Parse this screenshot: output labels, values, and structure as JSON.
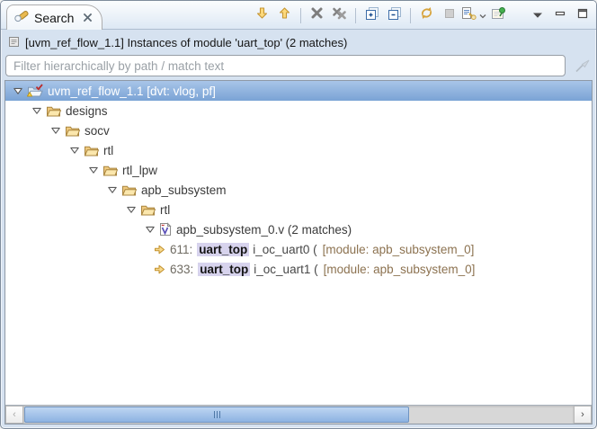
{
  "tab_bar": {
    "active_tab": {
      "label": "Search",
      "icon": "search-flashlight-icon",
      "close_icon": "close-icon"
    },
    "toolbar": {
      "buttons": [
        {
          "name": "show-next-match",
          "icon": "arrow-down-icon"
        },
        {
          "name": "show-previous-match",
          "icon": "arrow-up-icon"
        },
        {
          "type": "separator"
        },
        {
          "name": "remove-selected-match",
          "icon": "remove-match-icon"
        },
        {
          "name": "remove-all-matches",
          "icon": "remove-all-matches-icon"
        },
        {
          "type": "separator"
        },
        {
          "name": "expand-all",
          "icon": "expand-all-icon"
        },
        {
          "name": "collapse-all",
          "icon": "collapse-all-icon"
        },
        {
          "type": "separator"
        },
        {
          "name": "run-search-again",
          "icon": "refresh-icon"
        },
        {
          "name": "cancel-search",
          "icon": "stop-icon",
          "disabled": true
        },
        {
          "name": "previous-search-results",
          "icon": "search-history-icon",
          "has_dropdown": true
        },
        {
          "name": "pin-search-view",
          "icon": "pin-icon"
        },
        {
          "type": "spacer"
        },
        {
          "name": "view-menu",
          "icon": "view-menu-icon"
        },
        {
          "name": "minimize-view",
          "icon": "minimize-icon"
        },
        {
          "name": "maximize-view",
          "icon": "maximize-icon"
        }
      ]
    }
  },
  "header": {
    "icon": "search-result-icon",
    "text": "[uvm_ref_flow_1.1] Instances of module 'uart_top' (2 matches)"
  },
  "filter": {
    "placeholder": "Filter hierarchically by path / match text",
    "value": "",
    "clear_icon": "clear-filter-icon"
  },
  "tree": {
    "rows": [
      {
        "type": "node",
        "level": 0,
        "icon": "project-icon",
        "label": "uvm_ref_flow_1.1 [dvt: vlog, pf]",
        "expanded": true,
        "selected": true
      },
      {
        "type": "node",
        "level": 1,
        "icon": "folder-icon",
        "label": "designs",
        "expanded": true
      },
      {
        "type": "node",
        "level": 2,
        "icon": "folder-icon",
        "label": "socv",
        "expanded": true
      },
      {
        "type": "node",
        "level": 3,
        "icon": "folder-icon",
        "label": "rtl",
        "expanded": true
      },
      {
        "type": "node",
        "level": 4,
        "icon": "folder-icon",
        "label": "rtl_lpw",
        "expanded": true
      },
      {
        "type": "node",
        "level": 5,
        "icon": "folder-icon",
        "label": "apb_subsystem",
        "expanded": true
      },
      {
        "type": "node",
        "level": 6,
        "icon": "folder-icon",
        "label": "rtl",
        "expanded": true
      },
      {
        "type": "node",
        "level": 7,
        "icon": "verilog-file-icon",
        "label": "apb_subsystem_0.v (2 matches)",
        "expanded": true
      },
      {
        "type": "match",
        "icon": "match-arrow-icon",
        "line": "611:",
        "match": "uart_top",
        "rest": "i_oc_uart0 (",
        "decoration": "[module: apb_subsystem_0]"
      },
      {
        "type": "match",
        "icon": "match-arrow-icon",
        "line": "633:",
        "match": "uart_top",
        "rest": "i_oc_uart1 (",
        "decoration": "[module: apb_subsystem_0]"
      }
    ]
  },
  "scrollbar": {
    "orientation": "horizontal",
    "thumb_percent": 70,
    "left_arrow": "scroll-left-icon",
    "right_arrow": "scroll-right-icon"
  },
  "colors": {
    "selection_top": "#a8c5e8",
    "selection_bottom": "#7aa3d5",
    "match_highlight": "#d7d3ed",
    "decoration_text": "#8c7250",
    "frame": "#d6e2f0"
  }
}
